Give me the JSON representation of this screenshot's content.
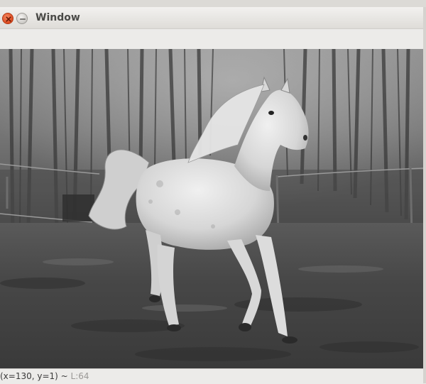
{
  "window": {
    "title": "Window"
  },
  "image": {
    "subject": "grayscale photo of a white horse galloping in a fenced paddock"
  },
  "status": {
    "coords": "(x=130, y=1)",
    "separator": " ~ ",
    "value": "L:64"
  },
  "icons": {
    "close": "close-icon",
    "minimize": "minimize-icon"
  },
  "colors": {
    "close_button": "#dd4a1f",
    "title_text": "#4a4a47",
    "status_value": "#9a9896"
  }
}
